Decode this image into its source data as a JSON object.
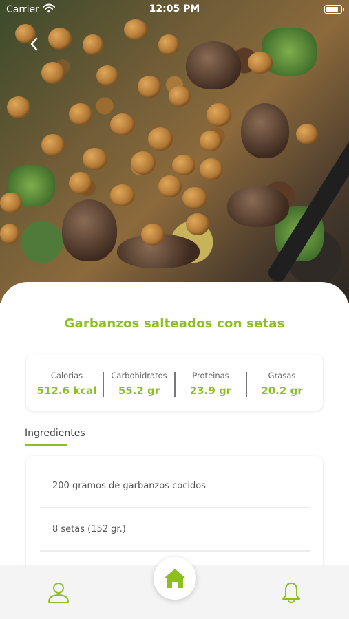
{
  "status_bar": {
    "carrier": "Carrier",
    "time": "12:05 PM"
  },
  "recipe": {
    "title": "Garbanzos salteados con setas"
  },
  "nutrition": [
    {
      "label": "Calorias",
      "value": "512.6 kcal"
    },
    {
      "label": "Carbohidratos",
      "value": "55.2 gr"
    },
    {
      "label": "Proteinas",
      "value": "23.9 gr"
    },
    {
      "label": "Grasas",
      "value": "20.2 gr"
    }
  ],
  "ingredients_section": {
    "title": "Ingredientes",
    "items": [
      "200 gramos de garbanzos cocidos",
      "8 setas (152 gr.)"
    ]
  },
  "colors": {
    "accent": "#8cbf1f",
    "tabbar": "#f4f4f4"
  },
  "icons": {
    "back": "chevron-left-icon",
    "profile": "user-icon",
    "home": "home-icon",
    "notifications": "bell-icon"
  }
}
